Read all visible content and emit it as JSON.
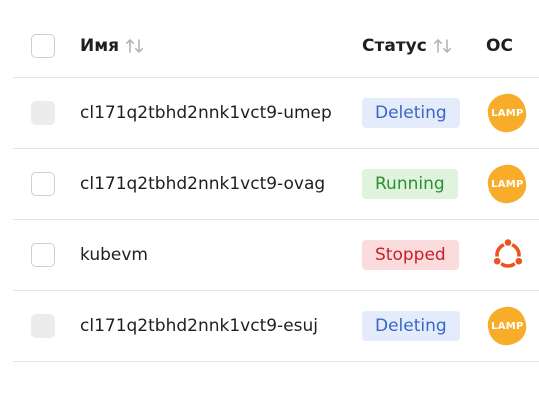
{
  "header": {
    "name_label": "Имя",
    "status_label": "Статус",
    "os_label": "ОС"
  },
  "rows": [
    {
      "name": "cl171q2tbhd2nnk1vct9-umep",
      "status": "Deleting",
      "os": "LAMP"
    },
    {
      "name": "cl171q2tbhd2nnk1vct9-ovag",
      "status": "Running",
      "os": "LAMP"
    },
    {
      "name": "kubevm",
      "status": "Stopped",
      "os": "ubuntu-icon"
    },
    {
      "name": "cl171q2tbhd2nnk1vct9-esuj",
      "status": "Deleting",
      "os": "LAMP"
    }
  ],
  "colors": {
    "deleting_bg": "#e4ecfb",
    "deleting_text": "#3867c6",
    "running_bg": "#dff4de",
    "running_text": "#2f8f2f",
    "stopped_bg": "#fbdcdc",
    "stopped_text": "#c7202a",
    "lamp_orange": "#f8ad2a",
    "ubuntu_orange": "#e95420"
  }
}
